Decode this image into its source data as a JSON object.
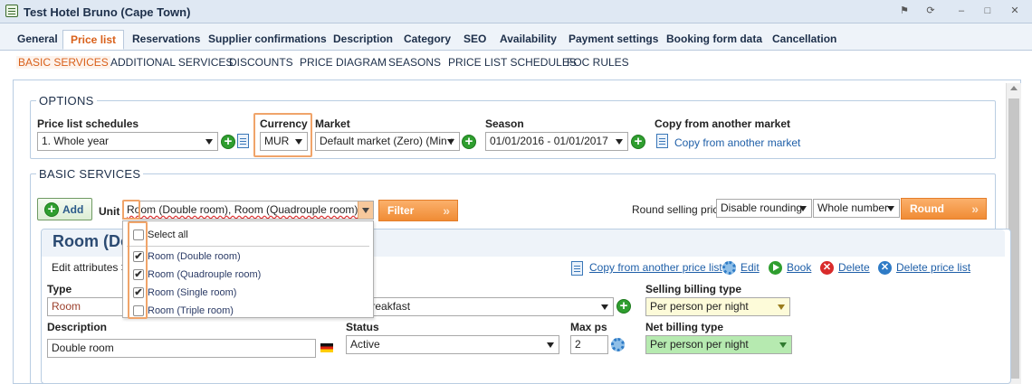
{
  "window": {
    "title": "Test Hotel Bruno (Cape Town)"
  },
  "main_tabs": [
    {
      "label": "General"
    },
    {
      "label": "Price list"
    },
    {
      "label": "Reservations"
    },
    {
      "label": "Supplier confirmations"
    },
    {
      "label": "Description"
    },
    {
      "label": "Category"
    },
    {
      "label": "SEO"
    },
    {
      "label": "Availability"
    },
    {
      "label": "Payment settings"
    },
    {
      "label": "Booking form data"
    },
    {
      "label": "Cancellation"
    }
  ],
  "active_main_tab": "Price list",
  "sub_tabs": [
    {
      "label": "BASIC SERVICES"
    },
    {
      "label": "ADDITIONAL SERVICES"
    },
    {
      "label": "DISCOUNTS"
    },
    {
      "label": "PRICE DIAGRAM"
    },
    {
      "label": "SEASONS"
    },
    {
      "label": "PRICE LIST SCHEDULES"
    },
    {
      "label": "FOC RULES"
    }
  ],
  "active_sub_tab": "BASIC SERVICES",
  "options": {
    "legend": "OPTIONS",
    "price_list_schedules": {
      "label": "Price list schedules",
      "value": "1. Whole year"
    },
    "currency": {
      "label": "Currency",
      "value": "MUR"
    },
    "market": {
      "label": "Market",
      "value": "Default market (Zero) (Min r"
    },
    "season": {
      "label": "Season",
      "value": "01/01/2016 - 01/01/2017"
    },
    "copy": {
      "label": "Copy from another market",
      "link": "Copy from another market"
    }
  },
  "basic_services": {
    "legend": "BASIC SERVICES",
    "add_button": "Add",
    "unit_label": "Unit",
    "unit_value": "Room (Double room), Room (Quadrouple room), Ro",
    "filter_button": "Filter",
    "round_selling_price_label": "Round selling price",
    "rounding_select": "Disable rounding",
    "number_select": "Whole number",
    "round_button": "Round"
  },
  "unit_dropdown": {
    "select_all": "Select all",
    "items": [
      {
        "label": "Room (Double room)",
        "checked": true
      },
      {
        "label": "Room (Quadrouple room)",
        "checked": true
      },
      {
        "label": "Room (Single room)",
        "checked": true
      },
      {
        "label": "Room (Triple room)",
        "checked": false
      }
    ],
    "check_mark": "✔"
  },
  "service_panel": {
    "title": "Room (Do",
    "edit_attributes": "Edit attributes >",
    "actions": {
      "copy_price_list": "Copy from another price list",
      "edit": "Edit",
      "book": "Book",
      "delete": "Delete",
      "delete_price_list": "Delete price list"
    },
    "type": {
      "label": "Type",
      "value": "Room"
    },
    "service_value": "nd breakfast",
    "selling_billing_type": {
      "label": "Selling billing type",
      "value": "Per person per night"
    },
    "description": {
      "label": "Description",
      "value": "Double room"
    },
    "status": {
      "label": "Status",
      "value": "Active"
    },
    "max_ps": {
      "label": "Max ps",
      "value": "2"
    },
    "net_billing_type": {
      "label": "Net billing type",
      "value": "Per person per night"
    },
    "service_label_tail": "e"
  },
  "colors": {
    "accent_orange": "#f08c35",
    "active_tab_text": "#d9601a",
    "link_blue": "#1f5fa8",
    "selling_billing_bg": "#fdfbd9",
    "net_billing_bg": "#b6eab0"
  }
}
